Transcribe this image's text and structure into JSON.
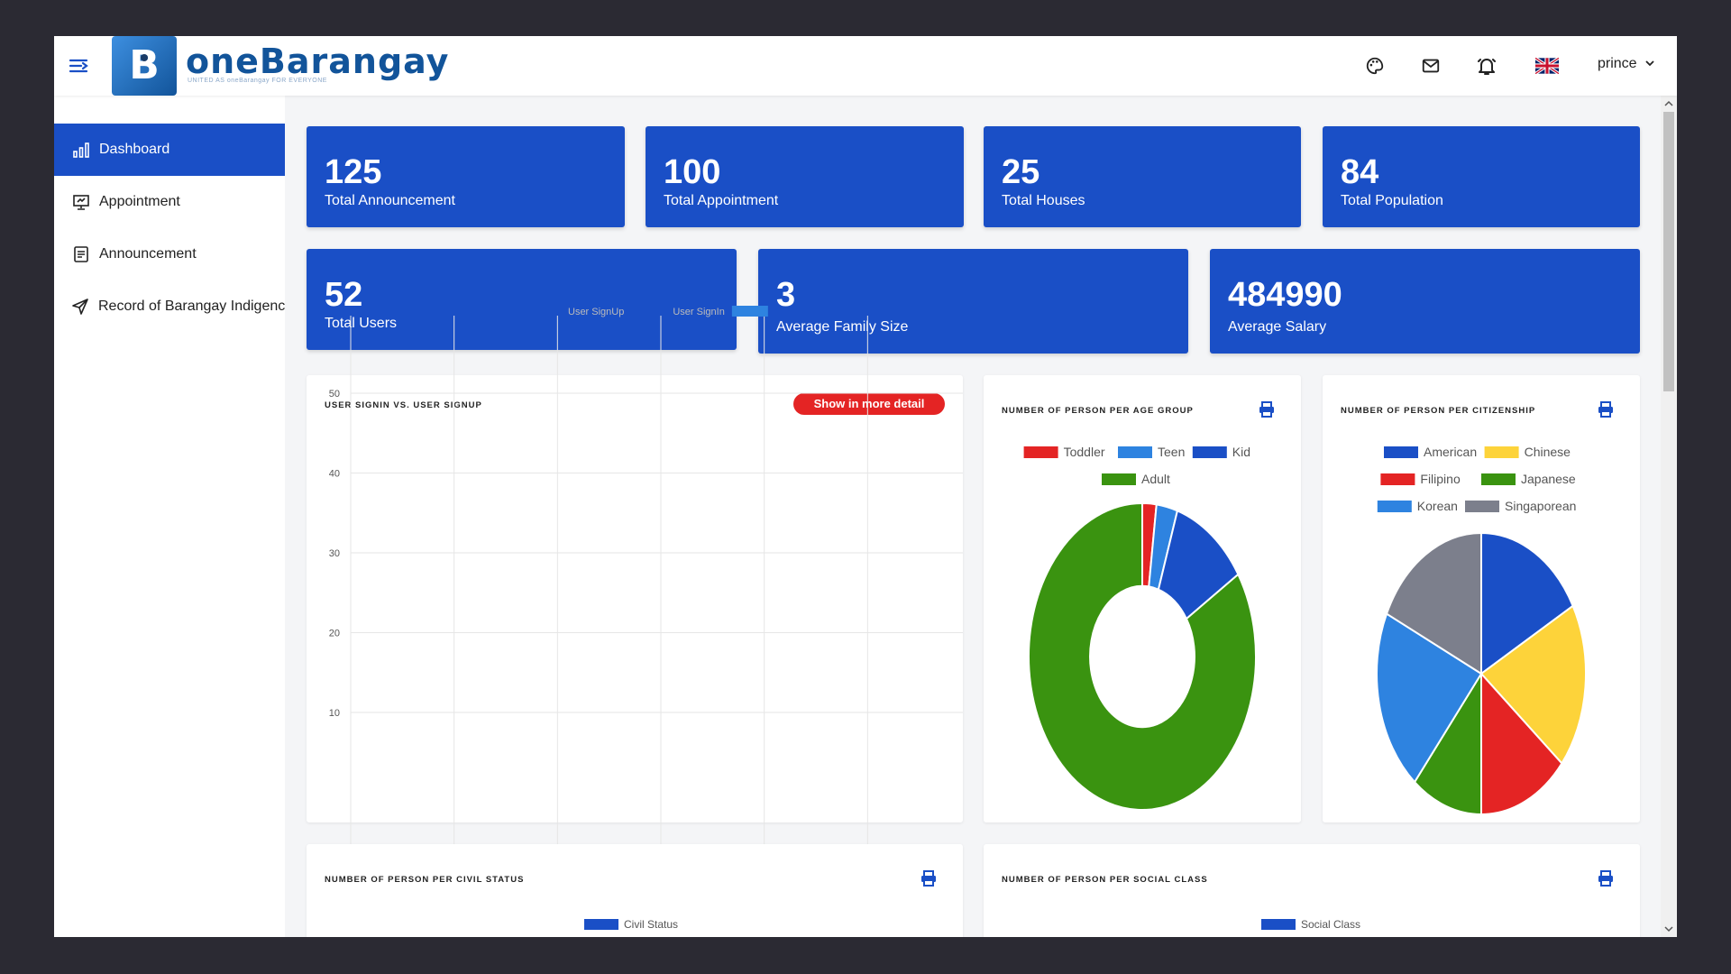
{
  "brand": {
    "name": "oneBarangay",
    "tagline": "UNITED AS oneBarangay FOR EVERYONE",
    "logo_letter": "B"
  },
  "topbar": {
    "user": "prince",
    "icons": [
      "palette-icon",
      "mail-icon",
      "bell-icon",
      "uk-flag-icon"
    ]
  },
  "sidebar": {
    "items": [
      {
        "label": "Dashboard",
        "icon": "bar-chart-icon",
        "active": true
      },
      {
        "label": "Appointment",
        "icon": "presentation-icon",
        "active": false
      },
      {
        "label": "Announcement",
        "icon": "document-icon",
        "active": false
      },
      {
        "label": "Record of Barangay Indigency",
        "icon": "send-icon",
        "active": false
      }
    ]
  },
  "stats": [
    {
      "value": "125",
      "label": "Total Announcement"
    },
    {
      "value": "100",
      "label": "Total Appointment"
    },
    {
      "value": "25",
      "label": "Total Houses"
    },
    {
      "value": "84",
      "label": "Total Population"
    },
    {
      "value": "52",
      "label": "Total Users"
    },
    {
      "value": "3",
      "label": "Average Family Size"
    },
    {
      "value": "484990",
      "label": "Average Salary"
    }
  ],
  "colors": {
    "primary": "#1a4fc6",
    "danger": "#e42424"
  },
  "panels": {
    "signin": {
      "title": "USER SIGNIN VS. USER SIGNUP",
      "button": "Show in more detail"
    },
    "age": {
      "title": "NUMBER OF PERSON PER AGE GROUP"
    },
    "citizenship": {
      "title": "NUMBER OF PERSON PER CITIZENSHIP"
    },
    "civil": {
      "title": "NUMBER OF PERSON PER CIVIL STATUS",
      "legend": "Civil Status"
    },
    "social": {
      "title": "NUMBER OF PERSON PER SOCIAL CLASS",
      "legend": "Social Class"
    }
  },
  "chart_data": [
    {
      "type": "line",
      "series": [
        {
          "name": "User SignUp",
          "color": "#cccccc",
          "values": []
        },
        {
          "name": "User SignIn",
          "color": "#2e83e0",
          "values": []
        }
      ],
      "yticks": [
        50,
        40,
        30,
        20,
        10
      ],
      "ylim": [
        10,
        50
      ],
      "grid": true,
      "legend": "top"
    },
    {
      "type": "pie",
      "donut": true,
      "labels": [
        "Toddler",
        "Teen",
        "Kid",
        "Adult"
      ],
      "colors": [
        "#e42424",
        "#2e83e0",
        "#1a4fc6",
        "#3a9310"
      ],
      "values": [
        2,
        3,
        11,
        84
      ],
      "legend": "top"
    },
    {
      "type": "pie",
      "labels": [
        "American",
        "Chinese",
        "Filipino",
        "Japanese",
        "Korean",
        "Singaporean"
      ],
      "colors": [
        "#1a4fc6",
        "#fdd33a",
        "#e42424",
        "#3a9310",
        "#2e83e0",
        "#7c7f8c"
      ],
      "values": [
        17,
        19,
        14,
        11,
        21,
        18
      ],
      "legend": "top"
    }
  ]
}
